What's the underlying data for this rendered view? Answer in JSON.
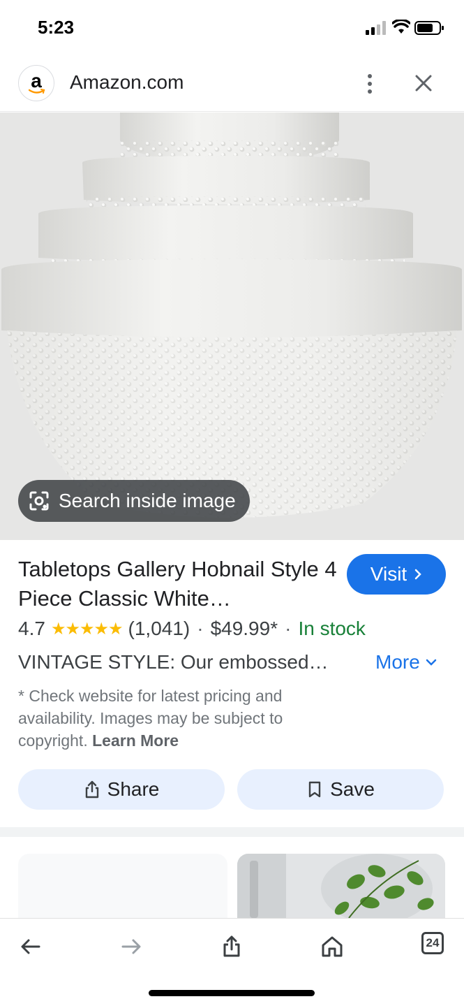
{
  "status_bar": {
    "time": "5:23"
  },
  "header": {
    "site_name": "Amazon.com",
    "site_icon_letter": "a"
  },
  "image": {
    "alt": "white hobnail mixing bowls",
    "lens_label": "Search inside image"
  },
  "product": {
    "title": "Tabletops Gallery Hobnail Style 4 Piece Classic White…",
    "visit_label": "Visit",
    "rating": "4.7",
    "stars": "★★★★★",
    "reviews": "(1,041)",
    "separator": "·",
    "price": "$49.99*",
    "availability": "In stock",
    "description": "VINTAGE STYLE: Our embossed…",
    "more_label": "More",
    "disclaimer_text": "* Check website for latest pricing and availability. Images may be subject to copyright.",
    "learn_more": "Learn More"
  },
  "actions": {
    "share_label": "Share",
    "save_label": "Save"
  },
  "bottom_nav": {
    "tab_count": "24"
  },
  "colors": {
    "accent": "#1a73e8",
    "in_stock": "#188038",
    "star": "#fbbc04",
    "chip_bg": "#e8f0fe"
  }
}
